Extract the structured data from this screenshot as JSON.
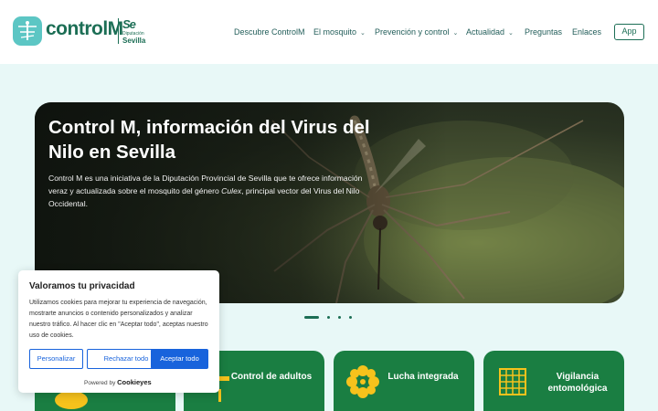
{
  "header": {
    "brand": "controlM",
    "partner_mark": "Se",
    "partner_sub": "Diputación",
    "partner_name": "Sevilla",
    "nav": [
      {
        "label": "Descubre ControlM",
        "dropdown": false
      },
      {
        "label": "El mosquito",
        "dropdown": true
      },
      {
        "label": "Prevención y control",
        "dropdown": true
      },
      {
        "label": "Actualidad",
        "dropdown": true
      },
      {
        "label": "Preguntas",
        "dropdown": false
      },
      {
        "label": "Enlaces",
        "dropdown": false
      }
    ],
    "app_button": "App"
  },
  "hero": {
    "title": "Control M, información del Virus del Nilo en Sevilla",
    "text_before": "Control M es una iniciativa de la Diputación Provincial de Sevilla que te ofrece información veraz y actualizada sobre el mosquito del género ",
    "text_italic": "Culex",
    "text_after": ", principal vector del Virus del Nilo Occidental."
  },
  "carousel": {
    "slide_count": 4,
    "active_index": 0
  },
  "cards": [
    {
      "label": "",
      "icon": "larva-icon"
    },
    {
      "label": "Control de adultos",
      "icon": "spray-icon"
    },
    {
      "label": "Lucha integrada",
      "icon": "flower-icon"
    },
    {
      "label": "Vigilancia entomológica",
      "icon": "grid-trap-icon"
    }
  ],
  "cookie": {
    "title": "Valoramos tu privacidad",
    "body": "Utilizamos cookies para mejorar tu experiencia de navegación, mostrarte anuncios o contenido personalizados y analizar nuestro tráfico. Al hacer clic en \"Aceptar todo\", aceptas nuestro uso de cookies.",
    "customize": "Personalizar",
    "reject": "Rechazar todo",
    "accept": "Aceptar todo",
    "powered_prefix": "Powered by",
    "powered_brand": "Cookieyes"
  },
  "colors": {
    "brand_green": "#1c6e55",
    "card_green": "#1a7e42",
    "page_bg": "#e8f8f7",
    "logo_teal": "#5cc6c4",
    "accent_yellow": "#f6c21c",
    "cookie_blue": "#1863dc"
  }
}
